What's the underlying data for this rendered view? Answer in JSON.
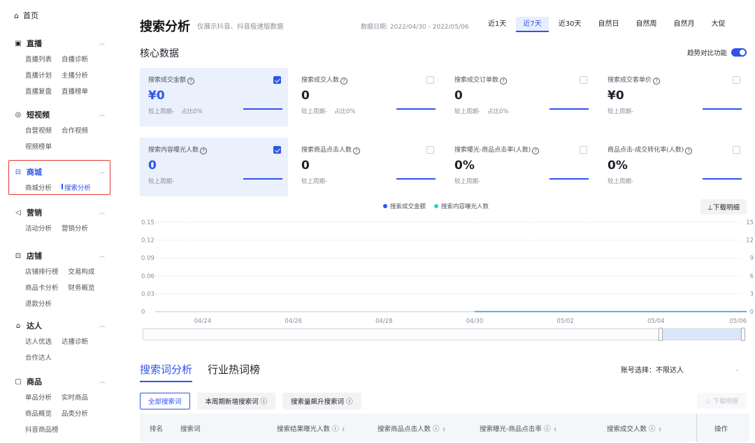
{
  "sidebar": {
    "home": "首页",
    "groups": [
      {
        "title": "直播",
        "icon": "▣",
        "rows": [
          [
            "直播列表",
            "自播诊断"
          ],
          [
            "直播计划",
            "主播分析"
          ],
          [
            "直播复盘",
            "直播榜单"
          ]
        ]
      },
      {
        "title": "短视频",
        "icon": "◎",
        "rows": [
          [
            "自营视频",
            "合作视频"
          ],
          [
            "视频榜单"
          ]
        ]
      },
      {
        "title": "商城",
        "icon": "⊟",
        "rows": [
          [
            "商城分析",
            "搜索分析"
          ]
        ]
      },
      {
        "title": "营销",
        "icon": "◁",
        "rows": [
          [
            "活动分析",
            "营销分析"
          ]
        ]
      },
      {
        "title": "店铺",
        "icon": "⊡",
        "rows": [
          [
            "店铺排行榜",
            "交易构成"
          ],
          [
            "商品卡分析",
            "财务概览"
          ],
          [
            "退款分析"
          ]
        ]
      },
      {
        "title": "达人",
        "icon": "⌂",
        "rows": [
          [
            "达人优选",
            "达播诊断"
          ],
          [
            "合作达人"
          ]
        ]
      },
      {
        "title": "商品",
        "icon": "▢",
        "rows": [
          [
            "单品分析",
            "实时商品"
          ],
          [
            "商品概览",
            "品类分析"
          ],
          [
            "抖音商品榜"
          ]
        ]
      }
    ]
  },
  "header": {
    "title": "搜索分析",
    "subtitle": "仅展示抖音、抖音极速版数据",
    "date_range": "数据日期: 2022/04/30 - 2022/05/06",
    "range_tabs": [
      "近1天",
      "近7天",
      "近30天",
      "自然日",
      "自然周",
      "自然月",
      "大促"
    ],
    "active_range": "近7天"
  },
  "core": {
    "title": "核心数据",
    "trend_label": "趋势对比功能",
    "cards": [
      {
        "label": "搜索成交金额",
        "value": "¥0",
        "foot": [
          "较上周期-",
          "占比0%"
        ],
        "selected": true
      },
      {
        "label": "搜索成交人数",
        "value": "0",
        "foot": [
          "较上周期-",
          "占比0%"
        ],
        "selected": false
      },
      {
        "label": "搜索成交订单数",
        "value": "0",
        "foot": [
          "较上周期-",
          "占比0%"
        ],
        "selected": false
      },
      {
        "label": "搜索成交客单价",
        "value": "¥0",
        "foot": [
          "较上周期-"
        ],
        "selected": false
      },
      {
        "label": "搜索内容曝光人数",
        "value": "0",
        "foot": [
          "较上周期-"
        ],
        "selected": true
      },
      {
        "label": "搜索商品点击人数",
        "value": "0",
        "foot": [
          "较上周期-"
        ],
        "selected": false
      },
      {
        "label": "搜索曝光-商品点击率(人数)",
        "value": "0%",
        "foot": [
          "较上周期-"
        ],
        "selected": false
      },
      {
        "label": "商品点击-成交转化率(人数)",
        "value": "0%",
        "foot": [
          "较上周期-"
        ],
        "selected": false
      }
    ]
  },
  "chart_legend": {
    "series": [
      {
        "name": "搜索成交金额",
        "color": "#2f54eb"
      },
      {
        "name": "搜索内容曝光人数",
        "color": "#36cfc9"
      }
    ],
    "download_label": "⊥下载明细"
  },
  "chart_data": {
    "type": "line",
    "x": [
      "04/24",
      "04/26",
      "04/28",
      "04/30",
      "05/02",
      "05/04",
      "05/06"
    ],
    "y_left_ticks": [
      "0.15",
      "0.12",
      "0.09",
      "0.06",
      "0.03",
      "0"
    ],
    "y_right_ticks": [
      "15",
      "12",
      "9",
      "6",
      "3",
      "0"
    ],
    "ylim_left": [
      0,
      0.15
    ],
    "ylim_right": [
      0,
      15
    ],
    "series": [
      {
        "name": "搜索成交金额",
        "x": [
          "04/30",
          "05/06"
        ],
        "values": [
          0,
          0
        ]
      },
      {
        "name": "搜索内容曝光人数",
        "x": [
          "04/30",
          "05/06"
        ],
        "values": [
          0,
          0
        ]
      }
    ]
  },
  "bottom": {
    "tabs": [
      "搜索词分析",
      "行业热词榜"
    ],
    "account_label": "账号选择：不限达人",
    "kw_tabs": [
      "全部搜索词",
      "本周期新增搜索词 ⓘ",
      "搜索量飙升搜索词 ⓘ"
    ],
    "kw_download": "⊥ 下载明细",
    "columns": [
      "排名",
      "搜索词",
      "搜索结果曝光人数 ⓘ",
      "搜索商品点击人数 ⓘ",
      "搜索曝光-商品点击率 ⓘ",
      "搜索成交人数 ⓘ",
      "操作"
    ]
  }
}
